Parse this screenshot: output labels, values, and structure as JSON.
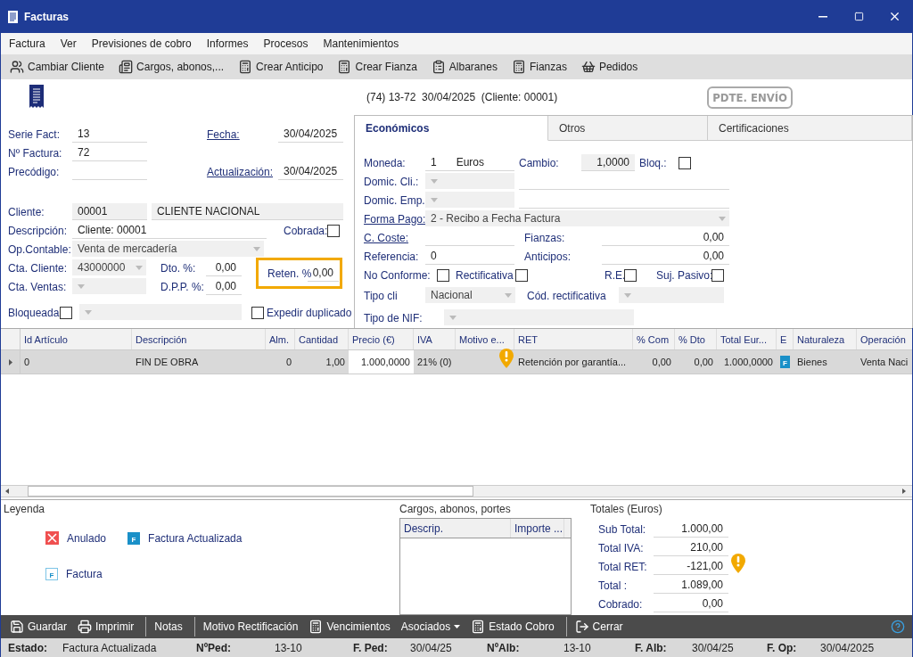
{
  "window": {
    "title": "Facturas"
  },
  "menu": [
    "Factura",
    "Ver",
    "Previsiones de cobro",
    "Informes",
    "Procesos",
    "Mantenimientos"
  ],
  "toolbar": [
    "Cambiar Cliente",
    "Cargos, abonos,...",
    "Crear Anticipo",
    "Crear Fianza",
    "Albaranes",
    "Fianzas",
    "Pedidos"
  ],
  "header": {
    "info": "(74) 13-72  30/04/2025  (Cliente: 00001)",
    "stamp": "PDTE. ENVÍO"
  },
  "general": {
    "serie": {
      "label": "Serie Fact:",
      "value": "13"
    },
    "fecha": {
      "label": "Fecha:",
      "value": "30/04/2025"
    },
    "numero": {
      "label": "Nº Factura:",
      "value": "72"
    },
    "precodigo": {
      "label": "Precódigo:"
    },
    "actualizacion": {
      "label": "Actualización:",
      "value": "30/04/2025"
    },
    "cliente": {
      "label": "Cliente:",
      "code": "00001",
      "name": "CLIENTE NACIONAL"
    },
    "descripcion": {
      "label": "Descripción:",
      "value": "Cliente: 00001"
    },
    "cobrada": {
      "label": "Cobrada:",
      "checked": false
    },
    "op_contable": {
      "label": "Op.Contable:",
      "value": "Venta de mercadería"
    },
    "cta_cliente": {
      "label": "Cta. Cliente:",
      "value": "43000000"
    },
    "dto": {
      "label": "Dto. %:",
      "value": "0,00"
    },
    "reten": {
      "label": "Reten. %",
      "value": "0,00",
      "highlighted": true
    },
    "cta_ventas": {
      "label": "Cta. Ventas:"
    },
    "dpp": {
      "label": "D.P.P. %:",
      "value": "0,00"
    },
    "bloqueada": {
      "label": "Bloqueada",
      "checked": false
    },
    "expedir": {
      "label": "Expedir duplicado",
      "checked": false
    }
  },
  "tabs": [
    {
      "label": "Económicos",
      "selected": true
    },
    {
      "label": "Otros",
      "selected": false
    },
    {
      "label": "Certificaciones",
      "selected": false
    }
  ],
  "economicos": {
    "moneda": {
      "label": "Moneda:",
      "code": "1",
      "name": "Euros"
    },
    "cambio": {
      "label": "Cambio:",
      "value": "1,0000"
    },
    "bloq": {
      "label": "Bloq.:",
      "checked": false
    },
    "domic_cli": {
      "label": "Domic. Cli.:"
    },
    "domic_emp": {
      "label": "Domic. Emp."
    },
    "forma_pago": {
      "label": "Forma Pago:",
      "value": "2 - Recibo a Fecha Factura"
    },
    "c_coste": {
      "label": "C. Coste:"
    },
    "fianzas": {
      "label": "Fianzas:",
      "value": "0,00"
    },
    "referencia": {
      "label": "Referencia:",
      "value": "0"
    },
    "anticipos": {
      "label": "Anticipos:",
      "value": "0,00"
    },
    "no_conforme": {
      "label": "No Conforme:",
      "checked": false
    },
    "rectificativa": {
      "label": "Rectificativa",
      "checked": false
    },
    "re": {
      "label": "R.E.",
      "checked": false
    },
    "suj_pasivo": {
      "label": "Suj. Pasivo:",
      "checked": false
    },
    "tipo_cli": {
      "label": "Tipo cli",
      "value": "Nacional"
    },
    "cod_rect": {
      "label": "Cód. rectificativa"
    },
    "tipo_nif": {
      "label": "Tipo de NIF:"
    }
  },
  "lines": {
    "columns": [
      {
        "label": "Id Artículo",
        "kind": "text"
      },
      {
        "label": "Descripción",
        "kind": "text"
      },
      {
        "label": "Alm.",
        "kind": "number"
      },
      {
        "label": "Cantidad",
        "kind": "number"
      },
      {
        "label": "Precio (€)",
        "kind": "edit"
      },
      {
        "label": "IVA",
        "kind": "text"
      },
      {
        "label": "Motivo e...",
        "kind": "text"
      },
      {
        "label": "RET",
        "kind": "text"
      },
      {
        "label": "% Com",
        "kind": "number"
      },
      {
        "label": "% Dto",
        "kind": "number"
      },
      {
        "label": "Total Eur...",
        "kind": "number"
      },
      {
        "label": "E",
        "kind": "badge"
      },
      {
        "label": "Naturaleza",
        "kind": "text"
      },
      {
        "label": "Operación",
        "kind": "text"
      }
    ],
    "rows": [
      {
        "selected": true,
        "warning": true,
        "cells": [
          "0",
          "FIN DE OBRA",
          "0",
          "1,00",
          "1.000,0000",
          "21% (0)",
          "",
          "Retención por garantía...",
          "0,00",
          "0,00",
          "1.000,0000",
          "F",
          "Bienes",
          "Venta Naci"
        ]
      }
    ]
  },
  "legend": {
    "title": "Leyenda",
    "items": [
      {
        "kind": "anulado",
        "label": "Anulado"
      },
      {
        "kind": "actualizada",
        "badge": "F",
        "label": "Factura Actualizada"
      },
      {
        "kind": "factura",
        "badge": "F",
        "label": "Factura"
      }
    ]
  },
  "cargos": {
    "title": "Cargos, abonos, portes",
    "columns": [
      "Descrip.",
      "Importe ..."
    ]
  },
  "totales": {
    "title": "Totales (Euros)",
    "rows": [
      {
        "label": "Sub Total:",
        "value": "1.000,00",
        "warning": false
      },
      {
        "label": "Total IVA:",
        "value": "210,00",
        "warning": false
      },
      {
        "label": "Total RET:",
        "value": "-121,00",
        "warning": true
      },
      {
        "label": "Total :",
        "value": "1.089,00",
        "warning": false
      },
      {
        "label": "Cobrado:",
        "value": "0,00",
        "warning": false
      }
    ]
  },
  "actions": [
    [
      {
        "label": "Guardar"
      },
      {
        "label": "Imprimir"
      }
    ],
    [
      {
        "label": "Notas"
      }
    ],
    [
      {
        "label": "Motivo Rectificación"
      },
      {
        "label": "Vencimientos"
      },
      {
        "label": "Asociados",
        "dropdown": true
      },
      {
        "label": "Estado Cobro"
      }
    ],
    [
      {
        "label": "Cerrar"
      }
    ]
  ],
  "status": [
    {
      "label": "Estado:",
      "value": "Factura Actualizada"
    },
    {
      "label": "NºPed:",
      "value": "13-10"
    },
    {
      "label": "F. Ped:",
      "value": "30/04/25"
    },
    {
      "label": "NºAlb:",
      "value": "13-10"
    },
    {
      "label": "F. Alb:",
      "value": "30/04/25"
    },
    {
      "label": "F. Op:",
      "value": "30/04/2025"
    }
  ]
}
